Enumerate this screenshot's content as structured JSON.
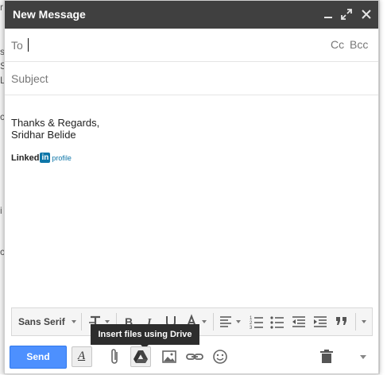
{
  "window": {
    "title": "New Message"
  },
  "recipients": {
    "to_label": "To",
    "cc_label": "Cc",
    "bcc_label": "Bcc"
  },
  "subject": {
    "placeholder": "Subject"
  },
  "body": {
    "signature": [
      "Thanks & Regards,",
      "Sridhar Belide"
    ],
    "linkedin": {
      "word": "Linked",
      "badge": "in",
      "link_text": "profile"
    }
  },
  "formatting": {
    "font_name": "Sans Serif"
  },
  "tooltip": {
    "text": "Insert files using Drive"
  },
  "actions": {
    "send_label": "Send"
  },
  "colors": {
    "titlebar": "#404040",
    "send_button": "#4d90fe",
    "linkedin": "#0e76a8",
    "tooltip": "#2d2d2d"
  },
  "icons": {
    "titlebar": [
      "minimize-icon",
      "popout-icon",
      "close-icon"
    ],
    "toolbar": [
      "text-size-icon",
      "bold-icon",
      "italic-icon",
      "underline-icon",
      "text-color-icon",
      "align-icon",
      "numbered-list-icon",
      "bulleted-list-icon",
      "indent-less-icon",
      "indent-more-icon",
      "quote-icon",
      "more-formatting-icon"
    ],
    "bottom": [
      "formatting-options-icon",
      "attach-icon",
      "drive-icon",
      "photo-icon",
      "link-icon",
      "emoji-icon",
      "trash-icon",
      "more-options-icon"
    ]
  }
}
